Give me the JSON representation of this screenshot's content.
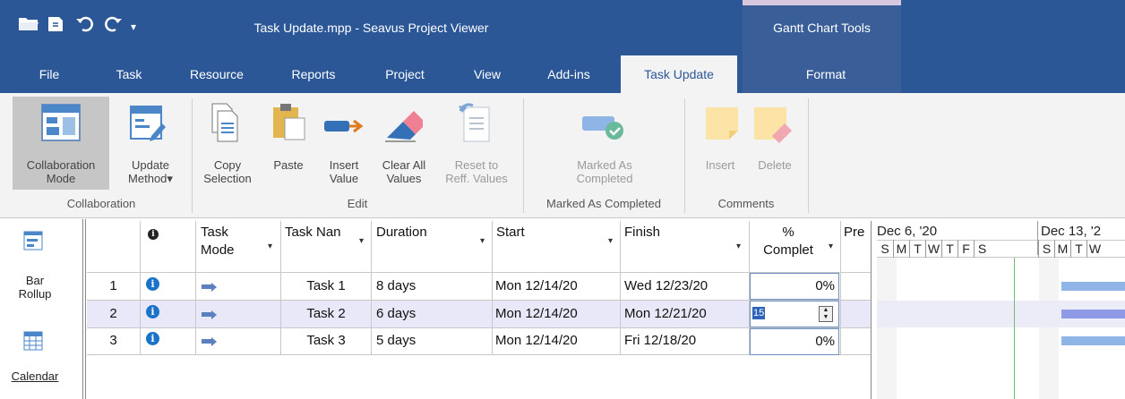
{
  "window": {
    "title": "Task Update.mpp - Seavus Project Viewer",
    "context_title": "Gantt Chart Tools"
  },
  "tabs": [
    "File",
    "Task",
    "Resource",
    "Reports",
    "Project",
    "View",
    "Add-ins",
    "Task Update",
    "Format"
  ],
  "active_tab": "Task Update",
  "ribbon": {
    "collaboration": {
      "collab_mode": [
        "Collaboration",
        "Mode"
      ],
      "update_method": [
        "Update",
        "Method▾"
      ],
      "label": "Collaboration"
    },
    "edit": {
      "copy": [
        "Copy",
        "Selection"
      ],
      "paste": "Paste",
      "insert_value": [
        "Insert",
        "Value"
      ],
      "clear_all": [
        "Clear All",
        "Values"
      ],
      "reset": [
        "Reset to",
        "Reff. Values"
      ],
      "label": "Edit"
    },
    "marked": {
      "btn": [
        "Marked As",
        "Completed"
      ],
      "label": "Marked As Completed"
    },
    "comments": {
      "insert": "Insert",
      "delete": "Delete",
      "label": "Comments"
    }
  },
  "left_panel": {
    "bar_rollup": [
      "Bar",
      "Rollup"
    ],
    "calendar": "Calendar"
  },
  "grid": {
    "headers": {
      "task_mode": [
        "Task",
        "Mode"
      ],
      "task_name": "Task Nan",
      "duration": "Duration",
      "start": "Start",
      "finish": "Finish",
      "pct": [
        "%",
        "Complet"
      ],
      "pre": "Pre"
    },
    "rows": [
      {
        "id": "1",
        "name": "Task 1",
        "duration": "8 days",
        "start": "Mon 12/14/20",
        "finish": "Wed 12/23/20",
        "pct": "0%"
      },
      {
        "id": "2",
        "name": "Task 2",
        "duration": "6 days",
        "start": "Mon 12/14/20",
        "finish": "Mon 12/21/20",
        "pct": "15"
      },
      {
        "id": "3",
        "name": "Task 3",
        "duration": "5 days",
        "start": "Mon 12/14/20",
        "finish": "Fri 12/18/20",
        "pct": "0%"
      }
    ]
  },
  "gantt": {
    "week1": "Dec 6, '20",
    "week2": "Dec 13, '2",
    "days": [
      "S",
      "M",
      "T",
      "W",
      "T",
      "F",
      "S",
      "S",
      "M",
      "T",
      "W"
    ]
  },
  "colors": {
    "title_bar": "#2b5797",
    "context_tab": "#3a5f98",
    "gantt_bar": "#8fb5e6",
    "selected_row": "#e8e8f8"
  }
}
